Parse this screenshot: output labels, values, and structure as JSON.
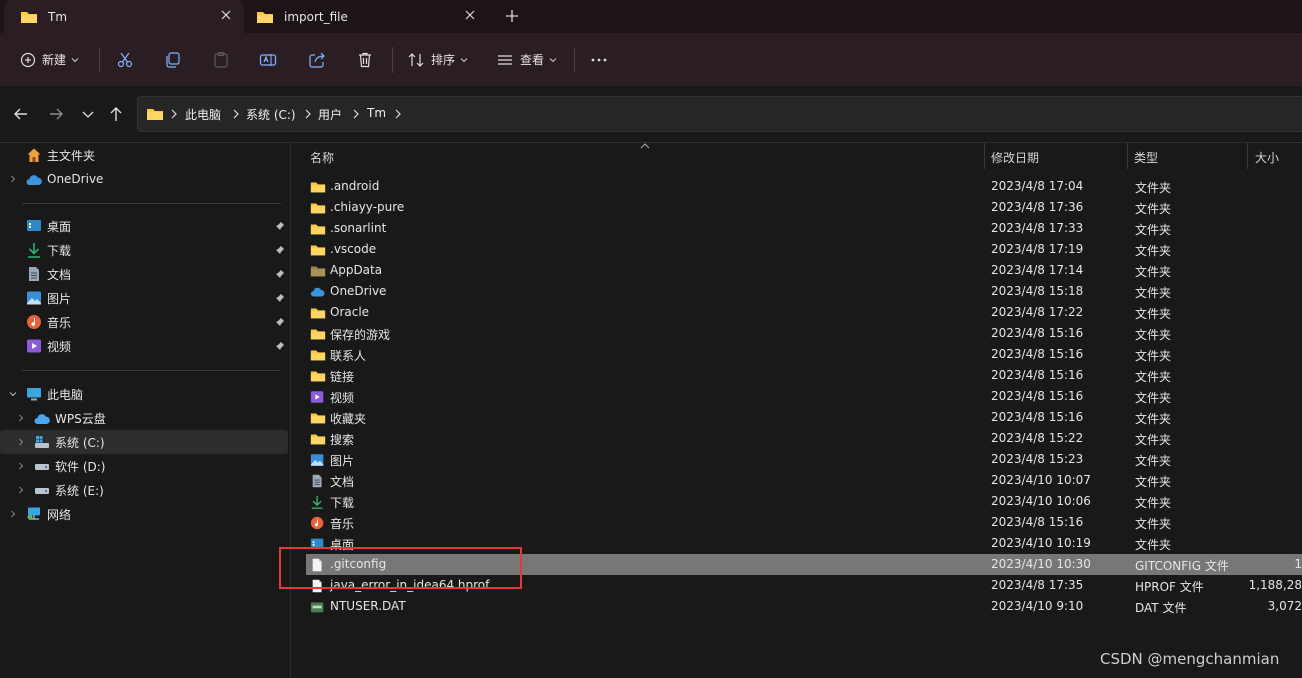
{
  "colors": {
    "accent": "#ffc83d",
    "selection": "#777777",
    "highlight": "#e03a3a"
  },
  "tabs": [
    {
      "label": "Tm",
      "icon": "folder-icon",
      "active": true
    },
    {
      "label": "import_file",
      "icon": "folder-icon",
      "active": false
    }
  ],
  "toolbar": {
    "new_label": "新建",
    "sort_label": "排序",
    "view_label": "查看"
  },
  "breadcrumb": [
    "此电脑",
    "系统 (C:)",
    "用户",
    "Tm"
  ],
  "sidebar": {
    "home": "主文件夹",
    "onedrive": "OneDrive",
    "quick": [
      {
        "label": "桌面",
        "icon": "desktop-icon"
      },
      {
        "label": "下载",
        "icon": "download-icon"
      },
      {
        "label": "文档",
        "icon": "document-icon"
      },
      {
        "label": "图片",
        "icon": "pictures-icon"
      },
      {
        "label": "音乐",
        "icon": "music-icon"
      },
      {
        "label": "视频",
        "icon": "video-icon"
      }
    ],
    "thispc": "此电脑",
    "drives": [
      {
        "label": "WPS云盘",
        "icon": "cloud-icon"
      },
      {
        "label": "系统 (C:)",
        "icon": "drive-c-icon"
      },
      {
        "label": "软件 (D:)",
        "icon": "drive-icon"
      },
      {
        "label": "系统 (E:)",
        "icon": "drive-icon"
      }
    ],
    "network": "网络"
  },
  "columns": {
    "name": "名称",
    "date": "修改日期",
    "type": "类型",
    "size": "大小"
  },
  "files": [
    {
      "name": ".android",
      "date": "2023/4/8 17:04",
      "type": "文件夹",
      "size": "",
      "icon": "folder-icon"
    },
    {
      "name": ".chiayy-pure",
      "date": "2023/4/8 17:36",
      "type": "文件夹",
      "size": "",
      "icon": "folder-icon"
    },
    {
      "name": ".sonarlint",
      "date": "2023/4/8 17:33",
      "type": "文件夹",
      "size": "",
      "icon": "folder-icon"
    },
    {
      "name": ".vscode",
      "date": "2023/4/8 17:19",
      "type": "文件夹",
      "size": "",
      "icon": "folder-icon"
    },
    {
      "name": "AppData",
      "date": "2023/4/8 17:14",
      "type": "文件夹",
      "size": "",
      "icon": "hidden-folder-icon"
    },
    {
      "name": "OneDrive",
      "date": "2023/4/8 15:18",
      "type": "文件夹",
      "size": "",
      "icon": "onedrive-icon"
    },
    {
      "name": "Oracle",
      "date": "2023/4/8 17:22",
      "type": "文件夹",
      "size": "",
      "icon": "folder-icon"
    },
    {
      "name": "保存的游戏",
      "date": "2023/4/8 15:16",
      "type": "文件夹",
      "size": "",
      "icon": "folder-icon"
    },
    {
      "name": "联系人",
      "date": "2023/4/8 15:16",
      "type": "文件夹",
      "size": "",
      "icon": "folder-icon"
    },
    {
      "name": "链接",
      "date": "2023/4/8 15:16",
      "type": "文件夹",
      "size": "",
      "icon": "folder-icon"
    },
    {
      "name": "视频",
      "date": "2023/4/8 15:16",
      "type": "文件夹",
      "size": "",
      "icon": "video-icon"
    },
    {
      "name": "收藏夹",
      "date": "2023/4/8 15:16",
      "type": "文件夹",
      "size": "",
      "icon": "folder-icon"
    },
    {
      "name": "搜索",
      "date": "2023/4/8 15:22",
      "type": "文件夹",
      "size": "",
      "icon": "folder-icon"
    },
    {
      "name": "图片",
      "date": "2023/4/8 15:23",
      "type": "文件夹",
      "size": "",
      "icon": "pictures-icon"
    },
    {
      "name": "文档",
      "date": "2023/4/10 10:07",
      "type": "文件夹",
      "size": "",
      "icon": "document-icon"
    },
    {
      "name": "下载",
      "date": "2023/4/10 10:06",
      "type": "文件夹",
      "size": "",
      "icon": "download-icon"
    },
    {
      "name": "音乐",
      "date": "2023/4/8 15:16",
      "type": "文件夹",
      "size": "",
      "icon": "music-icon"
    },
    {
      "name": "桌面",
      "date": "2023/4/10 10:19",
      "type": "文件夹",
      "size": "",
      "icon": "desktop-icon"
    },
    {
      "name": ".gitconfig",
      "date": "2023/4/10 10:30",
      "type": "GITCONFIG 文件",
      "size": "1",
      "icon": "file-icon",
      "selected": true
    },
    {
      "name": "java_error_in_idea64.hprof",
      "date": "2023/4/8 17:35",
      "type": "HPROF 文件",
      "size": "1,188,28",
      "icon": "file-icon"
    },
    {
      "name": "NTUSER.DAT",
      "date": "2023/4/10 9:10",
      "type": "DAT 文件",
      "size": "3,072",
      "icon": "dat-file-icon"
    }
  ],
  "watermark": "CSDN @mengchanmian"
}
